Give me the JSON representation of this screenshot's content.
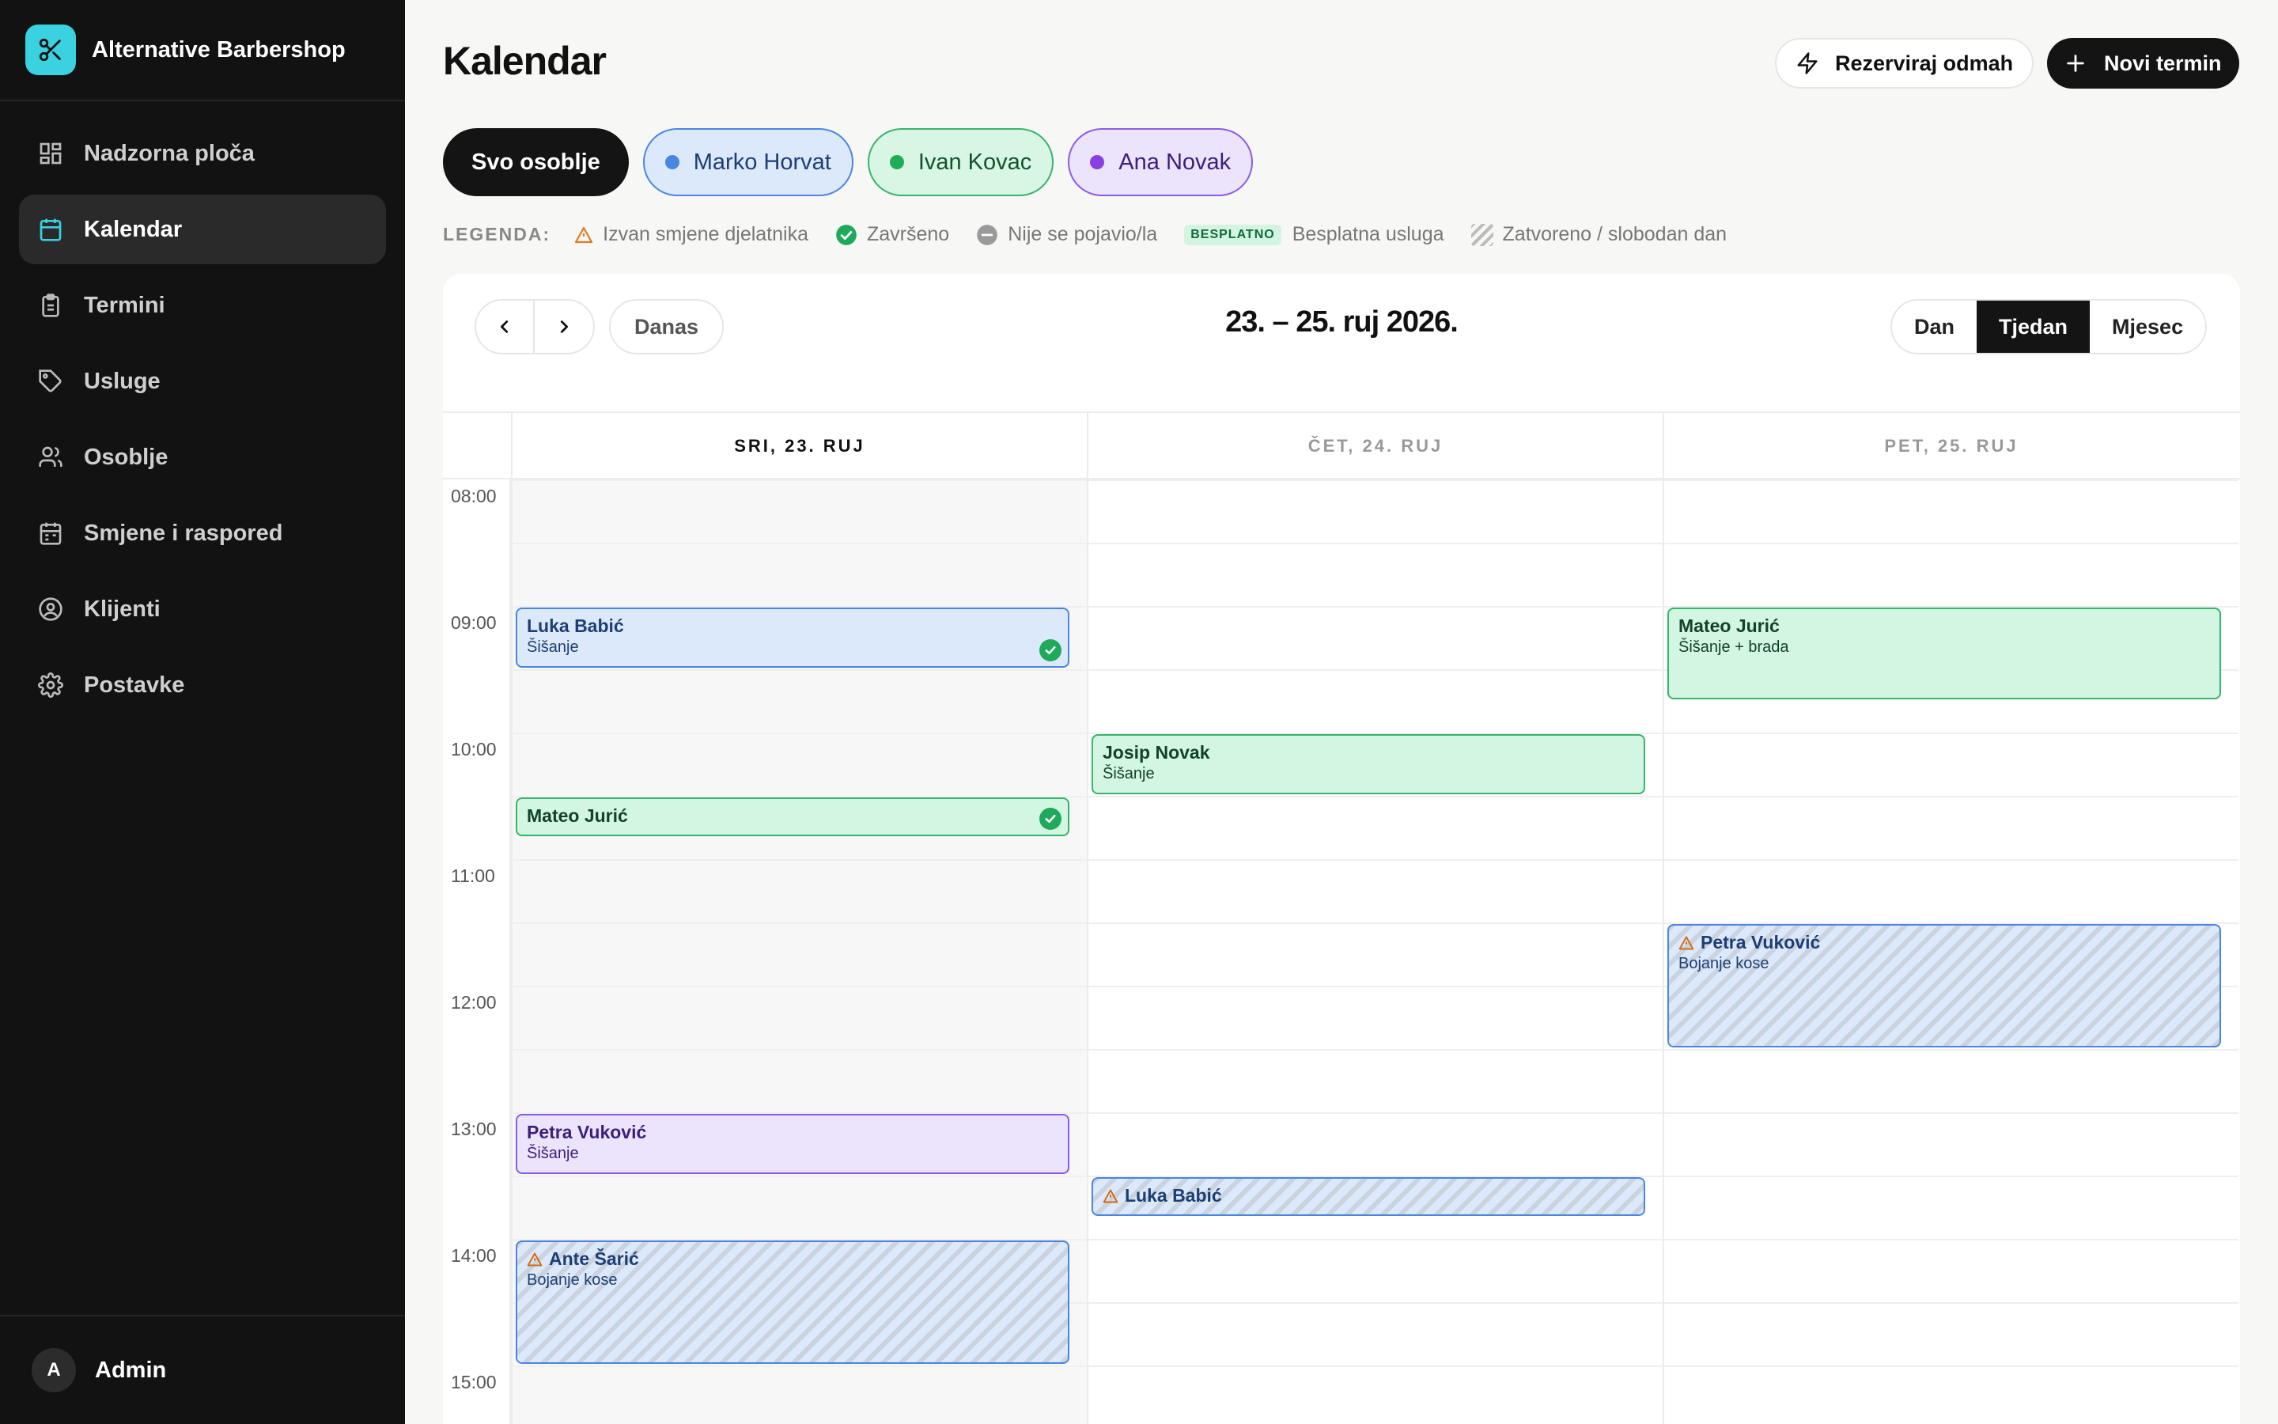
{
  "sidebar": {
    "brand": "Alternative Barbershop",
    "items": [
      {
        "label": "Nadzorna ploča",
        "icon": "dashboard-icon"
      },
      {
        "label": "Kalendar",
        "icon": "calendar-icon",
        "active": true
      },
      {
        "label": "Termini",
        "icon": "clipboard-icon"
      },
      {
        "label": "Usluge",
        "icon": "tag-icon"
      },
      {
        "label": "Osoblje",
        "icon": "users-icon"
      },
      {
        "label": "Smjene i raspored",
        "icon": "schedule-icon"
      },
      {
        "label": "Klijenti",
        "icon": "user-circle-icon"
      },
      {
        "label": "Postavke",
        "icon": "gear-icon"
      }
    ],
    "user": {
      "initial": "A",
      "name": "Admin"
    }
  },
  "header": {
    "title": "Kalendar",
    "quick_book": "Rezerviraj odmah",
    "new_appointment": "Novi termin"
  },
  "staff_filter": {
    "all": "Svo osoblje",
    "staff": [
      {
        "name": "Marko Horvat",
        "color": "#4a86e0"
      },
      {
        "name": "Ivan Kovac",
        "color": "#1fae55"
      },
      {
        "name": "Ana Novak",
        "color": "#8a3fe0"
      }
    ]
  },
  "legend": {
    "title": "LEGENDA:",
    "outside_shift": "Izvan smjene djelatnika",
    "completed": "Završeno",
    "no_show": "Nije se pojavio/la",
    "free_badge": "BESPLATNO",
    "free_service": "Besplatna usluga",
    "closed": "Zatvoreno / slobodan dan"
  },
  "calendar": {
    "range_title": "23. – 25. ruj 2026.",
    "today_button": "Danas",
    "views": [
      "Dan",
      "Tjedan",
      "Mjesec"
    ],
    "active_view": "Tjedan",
    "days": [
      "SRI, 23. RUJ",
      "ČET, 24. RUJ",
      "PET, 25. RUJ"
    ],
    "today_index": 0,
    "hours": [
      "08:00",
      "09:00",
      "10:00",
      "11:00",
      "12:00",
      "13:00",
      "14:00",
      "15:00"
    ],
    "events": [
      {
        "day": 0,
        "start": "09:00",
        "end": "09:30",
        "client": "Luka Babić",
        "service": "Šišanje",
        "staff": "Marko Horvat",
        "completed": true
      },
      {
        "day": 0,
        "start": "10:30",
        "end": "10:50",
        "client": "Mateo Jurić",
        "service": "",
        "staff": "Ivan Kovac",
        "completed": true
      },
      {
        "day": 0,
        "start": "13:00",
        "end": "13:30",
        "client": "Petra Vuković",
        "service": "Šišanje",
        "staff": "Ana Novak"
      },
      {
        "day": 0,
        "start": "14:00",
        "end": "15:00",
        "client": "Ante Šarić",
        "service": "Bojanje kose",
        "staff": "Marko Horvat",
        "outside_shift": true
      },
      {
        "day": 1,
        "start": "10:00",
        "end": "10:30",
        "client": "Josip Novak",
        "service": "Šišanje",
        "staff": "Ivan Kovac"
      },
      {
        "day": 1,
        "start": "13:30",
        "end": "13:50",
        "client": "Luka Babić",
        "service": "",
        "staff": "Marko Horvat",
        "outside_shift": true
      },
      {
        "day": 2,
        "start": "09:00",
        "end": "09:45",
        "client": "Mateo Jurić",
        "service": "Šišanje + brada",
        "staff": "Ivan Kovac"
      },
      {
        "day": 2,
        "start": "11:30",
        "end": "12:30",
        "client": "Petra Vuković",
        "service": "Bojanje kose",
        "staff": "Marko Horvat",
        "outside_shift": true
      }
    ]
  }
}
